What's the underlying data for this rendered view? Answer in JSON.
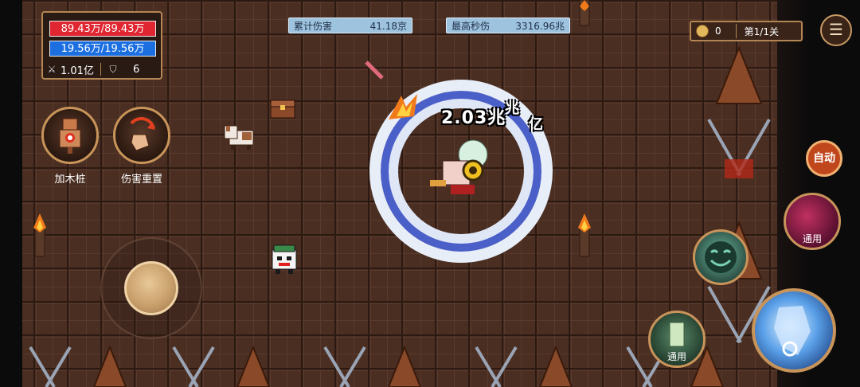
{
  "status": {
    "hp": "89.43万/89.43万",
    "mp": "19.56万/19.56万",
    "attack": "1.01亿",
    "defense": "6"
  },
  "top_stats": {
    "total_damage_label": "累计伤害",
    "total_damage_value": "41.18京",
    "max_dps_label": "最高秒伤",
    "max_dps_value": "3316.96兆"
  },
  "hud": {
    "coins": "0",
    "stage": "第1/1关"
  },
  "left_buttons": {
    "add_dummy": "加木桩",
    "reset_damage": "伤害重置"
  },
  "skills": {
    "auto": "自动",
    "skill1_label": "通用",
    "skill3_label": "通用"
  },
  "battle": {
    "damage_main": "2.03兆",
    "damage_back1": "兆",
    "damage_back2": "亿"
  },
  "colors": {
    "hp": "#e02630",
    "mp": "#1c6fe0",
    "panel_border": "#b38654",
    "stat_bg": "#9ec3df"
  }
}
